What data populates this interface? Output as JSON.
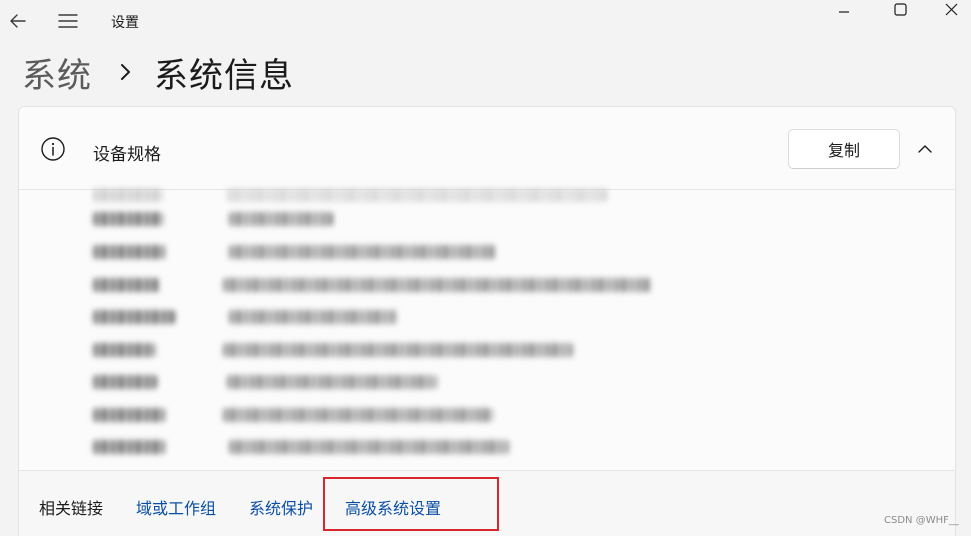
{
  "window": {
    "title": "设置"
  },
  "breadcrumb": {
    "parent": "系统",
    "current": "系统信息"
  },
  "device_specs": {
    "title": "设备规格",
    "copy_label": "复制",
    "rows_blurred": true,
    "row_count": 8
  },
  "related": {
    "label": "相关链接",
    "links": [
      "域或工作组",
      "系统保护",
      "高级系统设置"
    ],
    "highlighted_link": "高级系统设置"
  },
  "colors": {
    "link": "#0a4fa6",
    "highlight_box": "#d8262d",
    "background": "#f3f3f3",
    "card": "#fbfbfb"
  },
  "watermark": "CSDN @WHF__"
}
